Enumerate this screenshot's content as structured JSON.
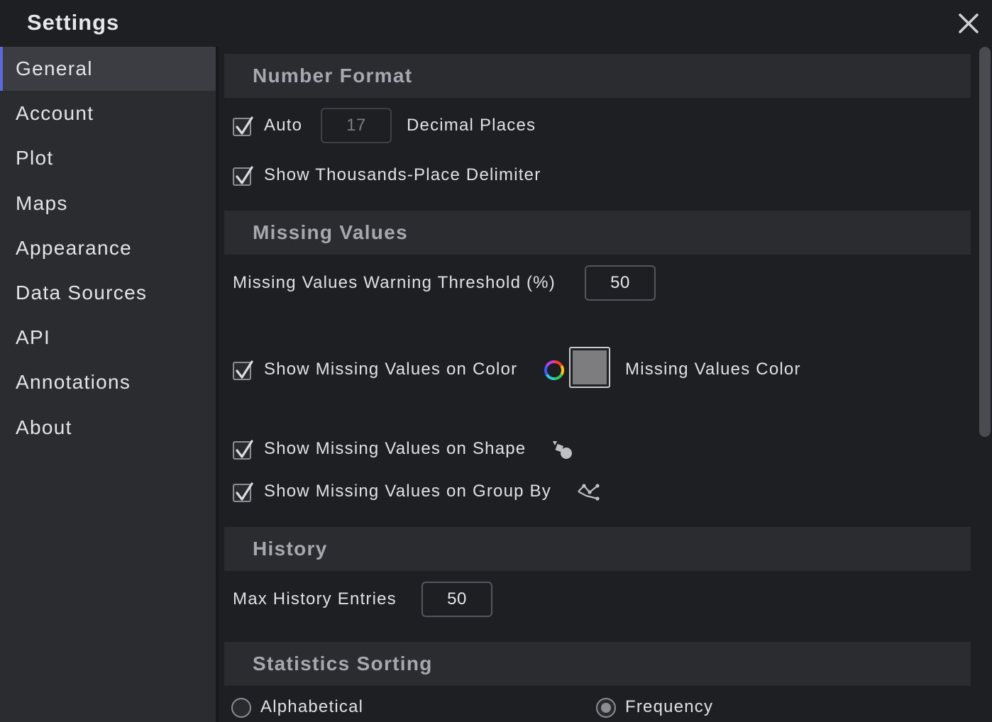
{
  "window": {
    "title": "Settings",
    "close_icon": "close-icon"
  },
  "sidebar": {
    "items": [
      {
        "label": "General",
        "active": true
      },
      {
        "label": "Account"
      },
      {
        "label": "Plot"
      },
      {
        "label": "Maps"
      },
      {
        "label": "Appearance"
      },
      {
        "label": "Data Sources"
      },
      {
        "label": "API"
      },
      {
        "label": "Annotations"
      },
      {
        "label": "About"
      }
    ],
    "accent_color": "#5b6ad8"
  },
  "number_format": {
    "header": "Number Format",
    "auto_label": "Auto",
    "auto_checked": true,
    "decimal_places_value": "17",
    "decimal_places_label": "Decimal Places",
    "thousands_label": "Show Thousands-Place Delimiter",
    "thousands_checked": true
  },
  "missing_values": {
    "header": "Missing Values",
    "threshold_label": "Missing Values Warning Threshold (%)",
    "threshold_value": "50",
    "on_color_label": "Show Missing Values on Color",
    "on_color_checked": true,
    "color_label": "Missing Values Color",
    "color_value": "#7d7d7f",
    "on_shape_label": "Show Missing Values on Shape",
    "on_shape_checked": true,
    "on_group_by_label": "Show Missing Values on Group By",
    "on_group_by_checked": true
  },
  "history": {
    "header": "History",
    "max_entries_label": "Max History Entries",
    "max_entries_value": "50"
  },
  "statistics_sorting": {
    "header": "Statistics Sorting",
    "options": [
      {
        "label": "Alphabetical",
        "checked": false
      },
      {
        "label": "Frequency",
        "checked": true
      }
    ]
  }
}
